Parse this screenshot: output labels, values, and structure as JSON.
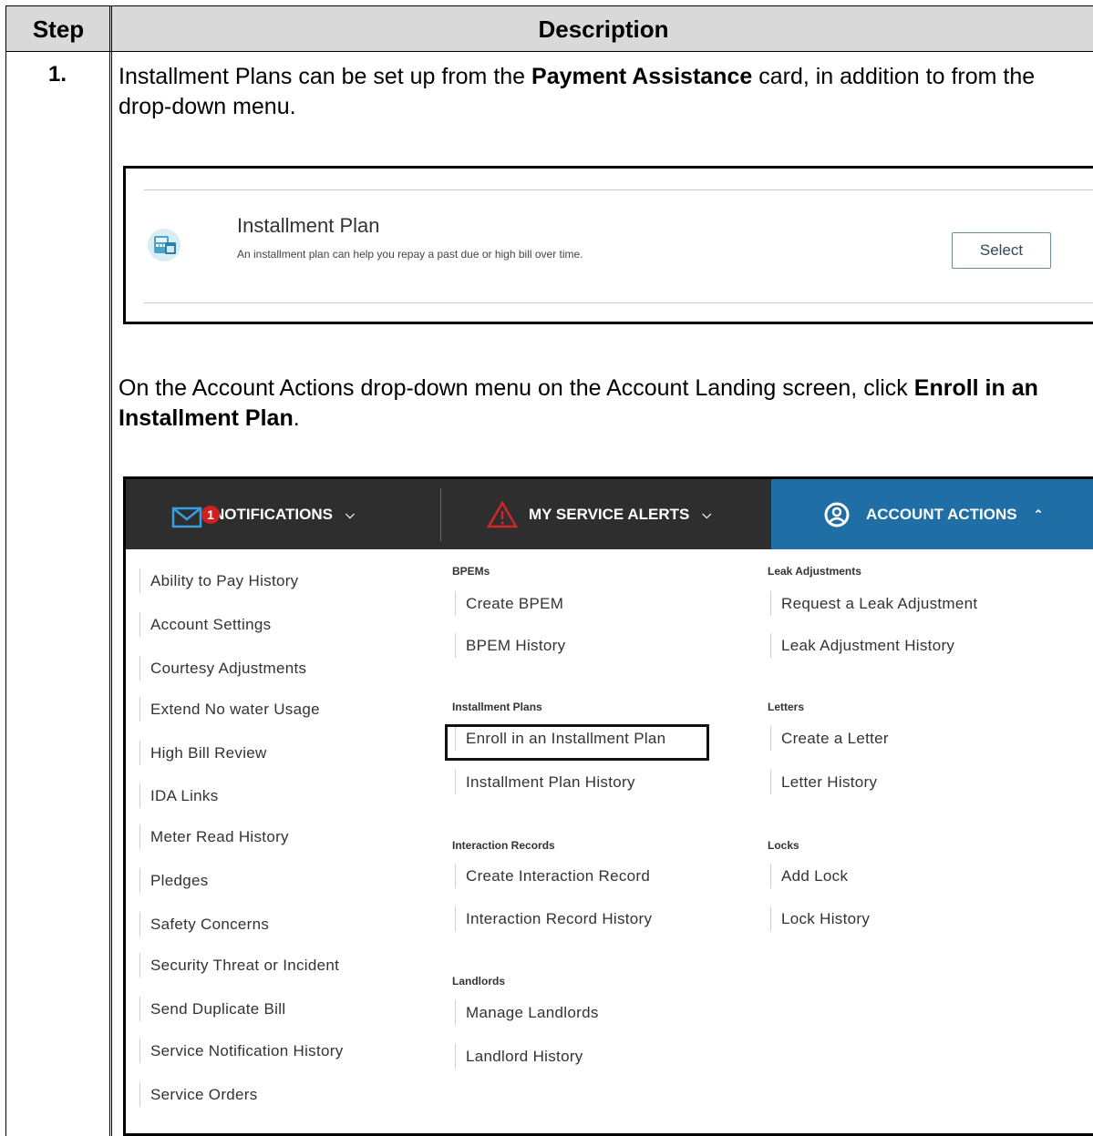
{
  "table": {
    "header_step": "Step",
    "header_description": "Description",
    "step_number": "1."
  },
  "instructions": {
    "p1_a": "Installment Plans can be set up from the ",
    "p1_bold": "Payment Assistance",
    "p1_b": " card, in addition to from the drop-down menu.",
    "p2_a": "On the Account Actions drop-down menu on the Account Landing screen, click ",
    "p2_bold": "Enroll in an Installment Plan",
    "p2_b": "."
  },
  "plan_card": {
    "title": "Installment Plan",
    "description": "An installment plan can help you repay a past due or high bill over time.",
    "select_label": "Select",
    "icon": "calculator-calendar-icon"
  },
  "topbar": {
    "notifications_label": "NOTIFICATIONS",
    "notifications_count": "1",
    "alerts_label": "MY SERVICE ALERTS",
    "account_actions_label": "ACCOUNT ACTIONS",
    "accent_color": "#1f6ea5"
  },
  "menu": {
    "col1": [
      "Ability to Pay History",
      "Account Settings",
      "Courtesy Adjustments",
      "Extend No water Usage",
      "High Bill Review",
      "IDA Links",
      "Meter Read History",
      "Pledges",
      "Safety Concerns",
      "Security Threat or Incident",
      "Send Duplicate Bill",
      "Service Notification History",
      "Service Orders"
    ],
    "bpems": {
      "heading": "BPEMs",
      "items": [
        "Create BPEM",
        "BPEM History"
      ]
    },
    "installment": {
      "heading": "Installment Plans",
      "items": [
        "Enroll in an Installment Plan",
        "Installment Plan History"
      ]
    },
    "interaction": {
      "heading": "Interaction Records",
      "items": [
        "Create Interaction Record",
        "Interaction Record History"
      ]
    },
    "landlords": {
      "heading": "Landlords",
      "items": [
        "Manage Landlords",
        "Landlord History"
      ]
    },
    "leak": {
      "heading": "Leak Adjustments",
      "items": [
        "Request a Leak Adjustment",
        "Leak Adjustment History"
      ]
    },
    "letters": {
      "heading": "Letters",
      "items": [
        "Create a Letter",
        "Letter History"
      ]
    },
    "locks": {
      "heading": "Locks",
      "items": [
        "Add Lock",
        "Lock History"
      ]
    }
  }
}
